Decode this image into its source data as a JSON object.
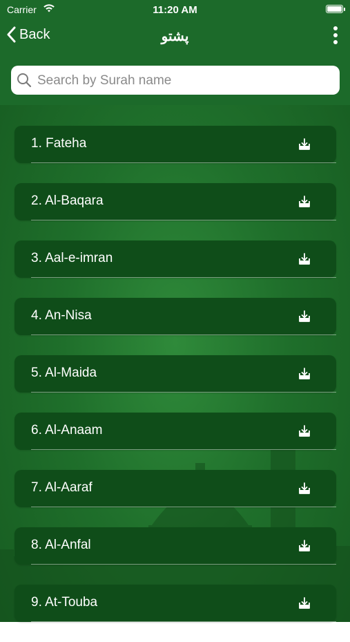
{
  "status_bar": {
    "carrier": "Carrier",
    "time": "11:20 AM"
  },
  "nav": {
    "back_label": "Back",
    "title": "پشتو"
  },
  "search": {
    "placeholder": "Search by Surah name",
    "value": ""
  },
  "colors": {
    "header": "#1c6a2a",
    "item_bg": "#0f4d19",
    "background": "#1f6f2b"
  },
  "surahs": [
    {
      "label": "1. Fateha"
    },
    {
      "label": "2. Al-Baqara"
    },
    {
      "label": "3. Aal-e-imran"
    },
    {
      "label": "4. An-Nisa"
    },
    {
      "label": "5. Al-Maida"
    },
    {
      "label": "6. Al-Anaam"
    },
    {
      "label": "7. Al-Aaraf"
    },
    {
      "label": "8. Al-Anfal"
    },
    {
      "label": "9. At-Touba"
    }
  ],
  "icons": {
    "download": "download-icon",
    "search": "search-icon",
    "back": "chevron-left-icon",
    "menu": "more-vertical-icon"
  }
}
